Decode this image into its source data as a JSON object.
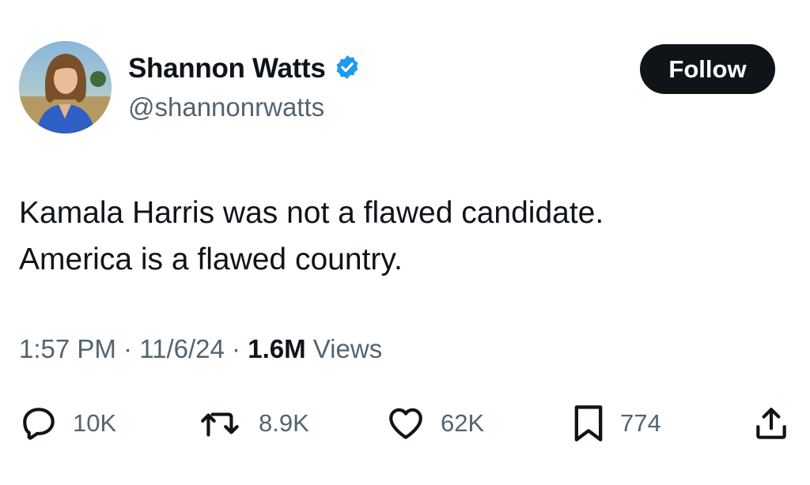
{
  "author": {
    "display_name": "Shannon Watts",
    "handle": "@shannonrwatts",
    "verified_icon": "verified-badge-icon",
    "verified_color": "#1d9bf0"
  },
  "follow_button": {
    "label": "Follow"
  },
  "tweet": {
    "lines": [
      "Kamala Harris was not a flawed candidate.",
      "America is a flawed country."
    ]
  },
  "meta": {
    "time": "1:57 PM",
    "sep1": " · ",
    "date": "11/6/24",
    "sep2": " · ",
    "views_count": "1.6M",
    "views_label": " Views"
  },
  "actions": {
    "reply": {
      "icon": "reply-icon",
      "count": "10K"
    },
    "retweet": {
      "icon": "retweet-icon",
      "count": "8.9K"
    },
    "like": {
      "icon": "heart-icon",
      "count": "62K"
    },
    "bookmark": {
      "icon": "bookmark-icon",
      "count": "774"
    },
    "share": {
      "icon": "share-icon"
    }
  },
  "colors": {
    "text": "#0f1419",
    "secondary": "#536471",
    "button_bg": "#0f1419"
  }
}
